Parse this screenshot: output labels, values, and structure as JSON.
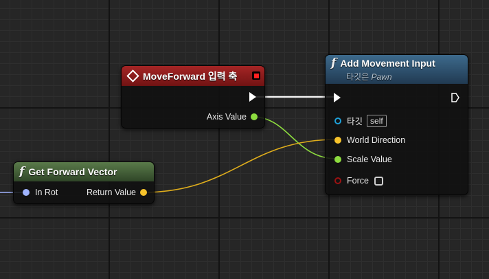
{
  "nodes": {
    "move_forward": {
      "title": "MoveForward 입력 축",
      "pins": {
        "axis_value": "Axis Value"
      }
    },
    "add_movement_input": {
      "title": "Add Movement Input",
      "subtitle_prefix": "타깃은",
      "subtitle_target": "Pawn",
      "pins": {
        "target": "타깃",
        "target_default": "self",
        "world_direction": "World Direction",
        "scale_value": "Scale Value",
        "force": "Force"
      }
    },
    "get_forward_vector": {
      "title": "Get Forward Vector",
      "pins": {
        "in_rot": "In Rot",
        "return_value": "Return Value"
      }
    }
  },
  "icons": {
    "function": "f",
    "event": "diamond-icon",
    "exec": "exec-pin-icon"
  },
  "colors": {
    "event_header": "#a52525",
    "function_header_blue": "#3d6a8c",
    "function_header_green": "#5a7b4a",
    "float_pin": "#8ddc3f",
    "vector_pin": "#f7c32b",
    "object_pin": "#1ea0d8",
    "rotator_pin": "#a0b4ff",
    "bool_pin": "#9a1212",
    "exec_wire": "#ffffff"
  }
}
